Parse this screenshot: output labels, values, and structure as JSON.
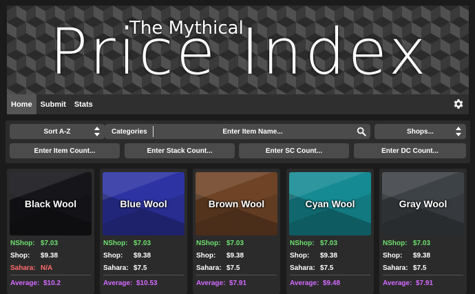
{
  "banner": {
    "subtitle": "The Mythical",
    "title": "Price Index"
  },
  "nav": {
    "items": [
      "Home",
      "Submit",
      "Stats"
    ],
    "active": "Home",
    "settings_icon": "gear-icon"
  },
  "controls": {
    "sort_value": "Sort A-Z",
    "categories_label": "Categories",
    "search_placeholder": "Enter Item Name...",
    "shops_value": "Shops...",
    "item_count_placeholder": "Enter Item Count...",
    "stack_count_placeholder": "Enter Stack Count...",
    "sc_count_placeholder": "Enter SC Count...",
    "dc_count_placeholder": "Enter DC Count..."
  },
  "labels": {
    "nshop": "NShop:",
    "shop": "Shop:",
    "sahara": "Sahara:",
    "average": "Average:"
  },
  "colors": {
    "nshop": "#6ee06e",
    "sahara_na": "#ff6b6b",
    "average": "#d36bff"
  },
  "items": [
    {
      "name": "Black Wool",
      "color": "#15151a",
      "nshop": "$7.03",
      "shop": "$9.38",
      "sahara": "N/A",
      "average": "$10.2"
    },
    {
      "name": "Blue Wool",
      "color": "#2d33a3",
      "nshop": "$7.03",
      "shop": "$9.38",
      "sahara": "$7.5",
      "average": "$10.53"
    },
    {
      "name": "Brown Wool",
      "color": "#6f4426",
      "nshop": "$7.03",
      "shop": "$9.38",
      "sahara": "$7.5",
      "average": "$7.91"
    },
    {
      "name": "Cyan Wool",
      "color": "#158a93",
      "nshop": "$7.03",
      "shop": "$9.38",
      "sahara": "$7.5",
      "average": "$9.48"
    },
    {
      "name": "Gray Wool",
      "color": "#3d4246",
      "nshop": "$7.03",
      "shop": "$9.38",
      "sahara": "$7.5",
      "average": "$7.91"
    }
  ]
}
